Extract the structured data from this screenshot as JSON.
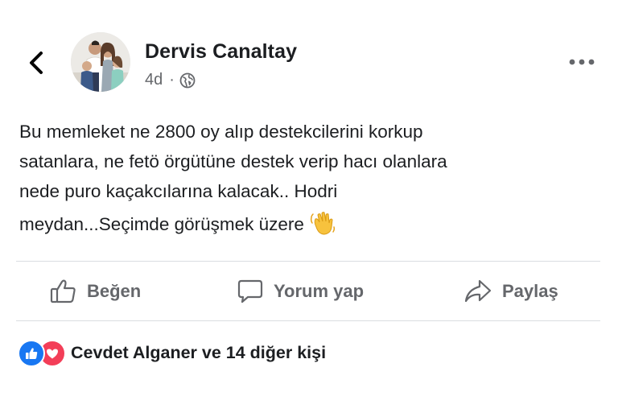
{
  "post": {
    "author": "Dervis Canaltay",
    "time": "4d",
    "separator": "·",
    "privacy_icon": "globe-icon",
    "text_lines": [
      "Bu memleket ne 2800 oy alıp destekcilerini korkup",
      "satanlara, ne fetö örgütüne destek verip hacı olanlara",
      "nede puro kaçakcılarına kalacak.. Hodri",
      "meydan...Seçimde görüşmek üzere"
    ],
    "emoji": "waving-hand-emoji"
  },
  "actions": {
    "like_label": "Beğen",
    "comment_label": "Yorum yap",
    "share_label": "Paylaş"
  },
  "reactions": {
    "icons": [
      "like-reaction-icon",
      "love-reaction-icon"
    ],
    "summary": "Cevdet Alganer ve 14 diğer kişi"
  },
  "colors": {
    "like_blue": "#1877f2",
    "love_red": "#f33e58",
    "muted_text": "#65676b",
    "divider": "#dadde1"
  }
}
